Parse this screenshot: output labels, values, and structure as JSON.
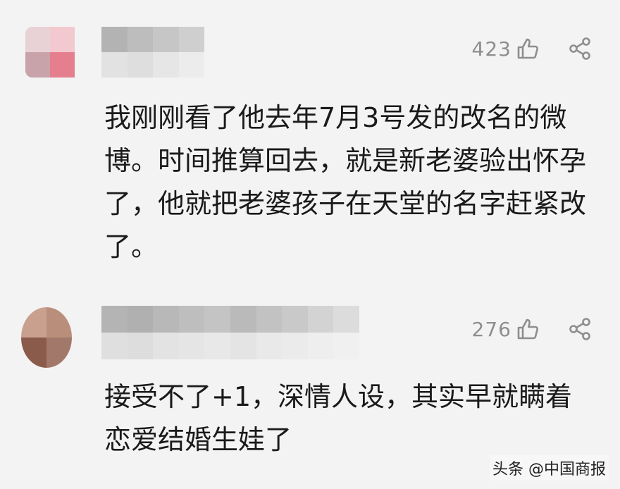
{
  "comments": [
    {
      "likes": "423",
      "text": "我刚刚看了他去年7月3号发的改名的微\n博。时间推算回去，就是新老婆验出怀孕\n了，他就把老婆孩子在天堂的名字赶紧改\n了。"
    },
    {
      "likes": "276",
      "text": "接受不了+1，深情人设，其实早就瞒着\n恋爱结婚生娃了"
    }
  ],
  "watermark": "头条 @中国商报",
  "icons": {
    "like": "thumbs-up-icon",
    "share": "share-icon"
  },
  "colors": {
    "background": "#f3f3f3",
    "text": "#1a1a1a",
    "meta": "#8e8e8e"
  }
}
